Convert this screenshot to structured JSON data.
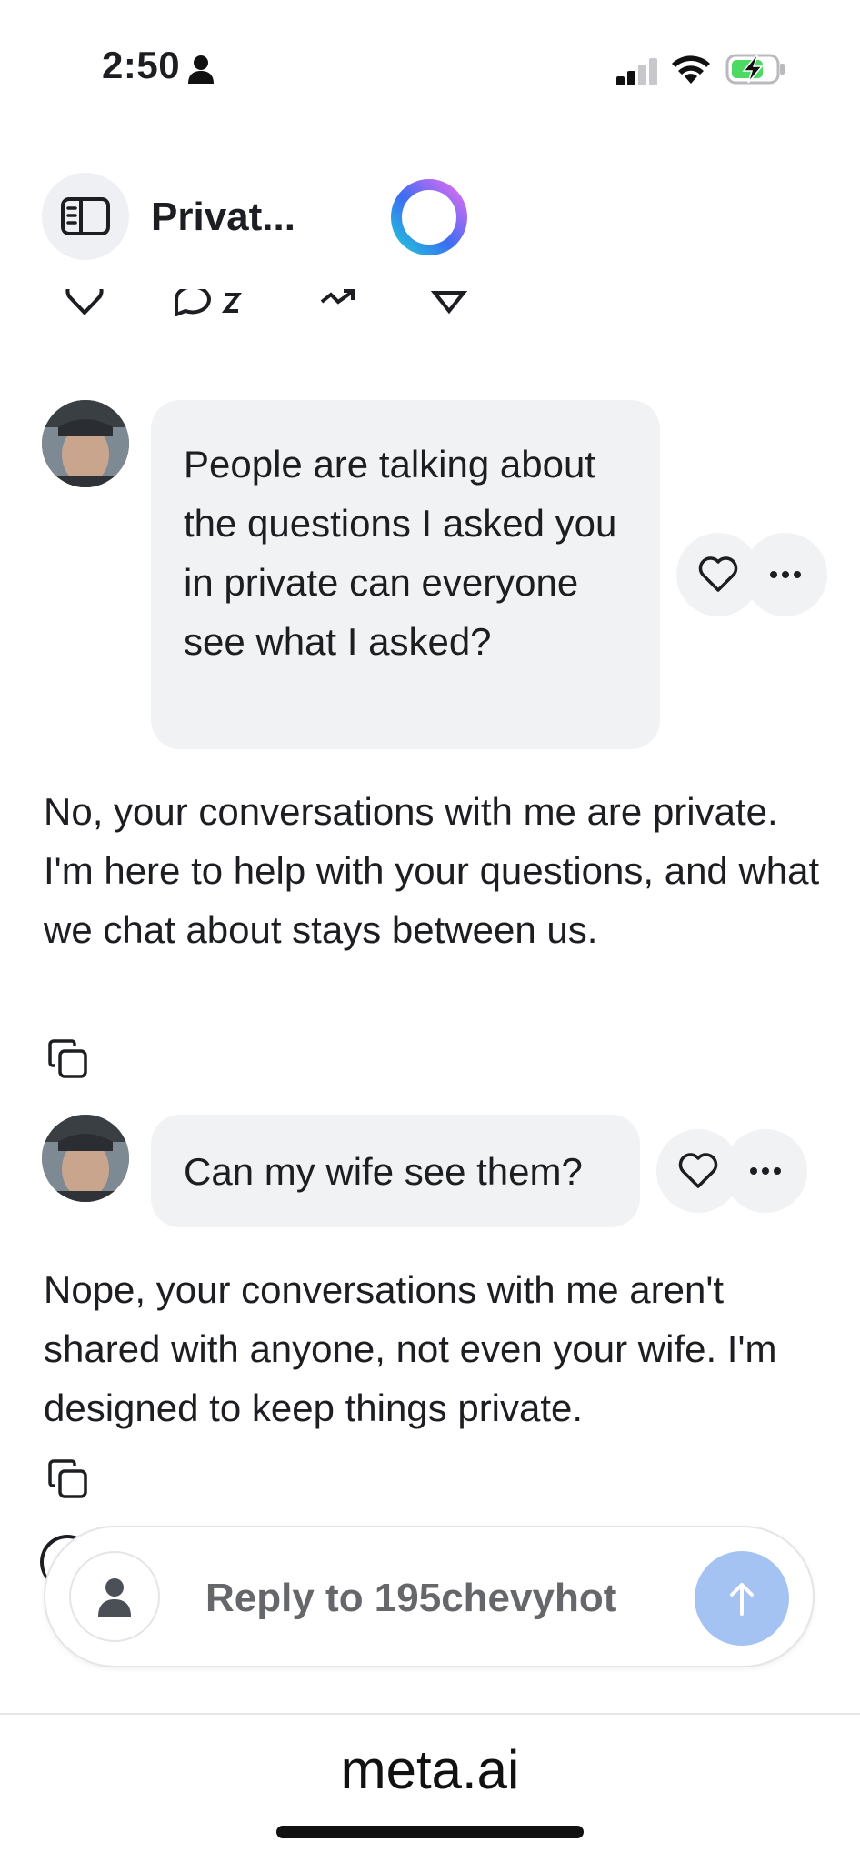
{
  "status_bar": {
    "time": "2:50",
    "battery_color": "#4cd964"
  },
  "header": {
    "title": "Privat...",
    "sidebar_icon": "sidebar-panel-icon",
    "assistant_icon": "meta-ai-ring-icon"
  },
  "messages": [
    {
      "role": "user",
      "text": "People are talking about the questions I asked you in private can everyone see what I asked?",
      "actions": [
        "heart-icon",
        "more-icon"
      ]
    },
    {
      "role": "assistant",
      "text": "No, your conversations with me are private. I'm here to help with your questions, and what we chat about stays between us.",
      "actions": [
        "copy-icon"
      ]
    },
    {
      "role": "user",
      "text": "Can my wife see them?",
      "actions": [
        "heart-icon",
        "more-icon"
      ]
    },
    {
      "role": "assistant",
      "text": "Nope, your conversations with me aren't shared with anyone, not even your wife. I'm designed to keep things private.",
      "actions": [
        "copy-icon"
      ]
    }
  ],
  "reply": {
    "placeholder": "Reply to 195chevyhot",
    "send_color": "#a4c3f2"
  },
  "browser": {
    "domain": "meta.ai"
  }
}
